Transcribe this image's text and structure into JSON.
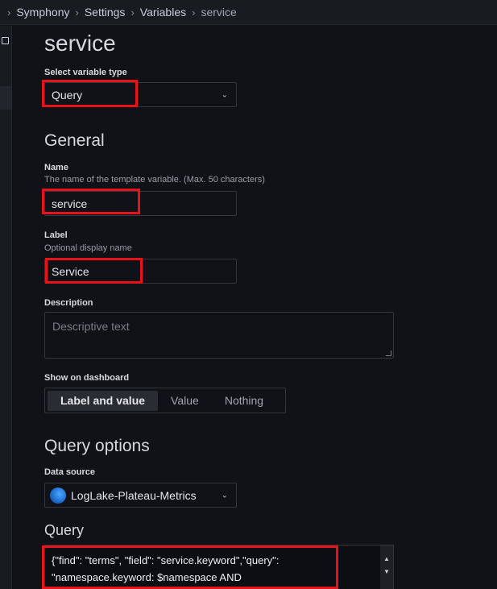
{
  "breadcrumb": [
    "Symphony",
    "Settings",
    "Variables",
    "service"
  ],
  "page_title": "service",
  "variable_type": {
    "label": "Select variable type",
    "value": "Query"
  },
  "general": {
    "title": "General",
    "name": {
      "label": "Name",
      "hint": "The name of the template variable. (Max. 50 characters)",
      "value": "service"
    },
    "display_label": {
      "label": "Label",
      "hint": "Optional display name",
      "value": "Service"
    },
    "description": {
      "label": "Description",
      "placeholder": "Descriptive text"
    },
    "show_on_dashboard": {
      "label": "Show on dashboard",
      "options": [
        "Label and value",
        "Value",
        "Nothing"
      ],
      "selected": "Label and value"
    }
  },
  "query_options": {
    "title": "Query options",
    "data_source": {
      "label": "Data source",
      "value": "LogLake-Plateau-Metrics",
      "icon": "datasource-icon"
    },
    "query": {
      "label": "Query",
      "lines": [
        "{\"find\": \"terms\", \"field\": \"service.keyword\",\"query\":",
        "\"namespace.keyword: $namespace AND"
      ]
    }
  },
  "colors": {
    "background": "#111217",
    "highlight": "#e8131a",
    "text": "#d8d9e0"
  }
}
